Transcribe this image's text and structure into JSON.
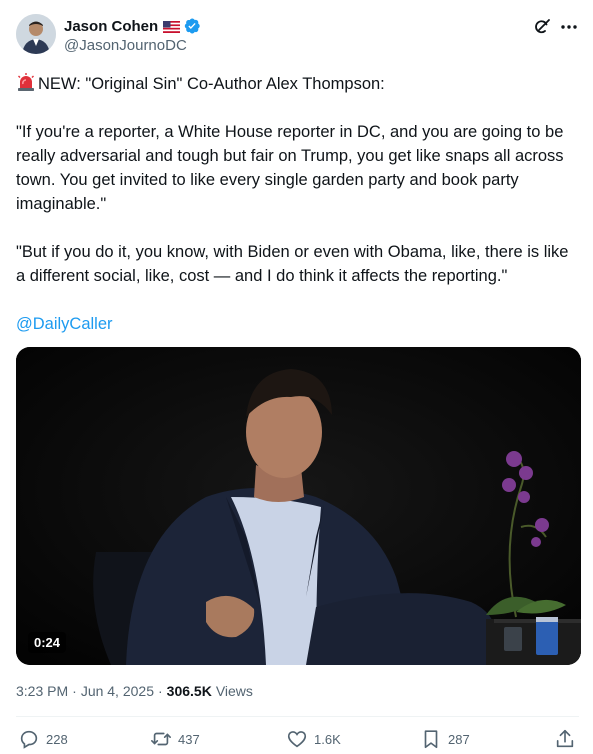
{
  "author": {
    "display_name": "Jason Cohen",
    "handle": "@JasonJournoDC"
  },
  "tweet": {
    "paragraphs": [
      "NEW: \"Original Sin\" Co-Author Alex Thompson:",
      "\"If you're a reporter, a White House reporter in DC, and you are going to be really adversarial and tough but fair on Trump, you get like snaps all across town. You get invited to like every single garden party and book party imaginable.\"",
      "\"But if you do it, you know, with Biden or even with Obama, like, there is like a different social, like, cost — and I do think it affects the reporting.\""
    ],
    "mention": "@DailyCaller"
  },
  "media": {
    "duration": "0:24"
  },
  "meta": {
    "time": "3:23 PM",
    "date": "Jun 4, 2025",
    "views_count": "306.5K",
    "views_label": "Views"
  },
  "actions": {
    "replies": "228",
    "reposts": "437",
    "likes": "1.6K",
    "bookmarks": "287"
  },
  "colors": {
    "accent": "#1d9bf0",
    "text": "#0f1419",
    "muted": "#536471"
  },
  "icons": [
    "flag-us-icon",
    "verified-badge-icon",
    "grok-icon",
    "more-icon",
    "alert-light-icon",
    "reply-icon",
    "repost-icon",
    "like-icon",
    "bookmark-icon",
    "share-icon"
  ]
}
